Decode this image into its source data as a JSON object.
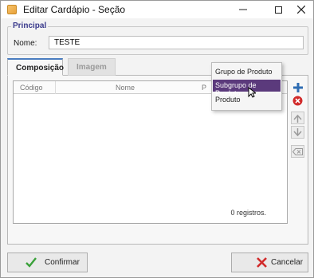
{
  "window": {
    "title": "Editar Cardápio - Seção"
  },
  "principal": {
    "group_title": "Principal",
    "nome_label": "Nome:",
    "nome_value": "TESTE"
  },
  "tabs": [
    {
      "label": "Composição",
      "active": true
    },
    {
      "label": "Imagem",
      "active": false
    }
  ],
  "grid": {
    "columns": [
      "Código",
      "Nome",
      "P"
    ],
    "footer": "0 registros."
  },
  "menu": {
    "items": [
      {
        "label": "Grupo de Produto",
        "selected": false
      },
      {
        "label": "Subgrupo de Produto",
        "selected": true
      },
      {
        "label": "Produto",
        "selected": false
      }
    ]
  },
  "buttons": {
    "confirm": "Confirmar",
    "cancel": "Cancelar"
  },
  "colors": {
    "menu_highlight": "#5b3a7c",
    "group_title": "#3a3a8c",
    "add_icon": "#2f6db3",
    "remove_icon": "#d12b2b"
  }
}
